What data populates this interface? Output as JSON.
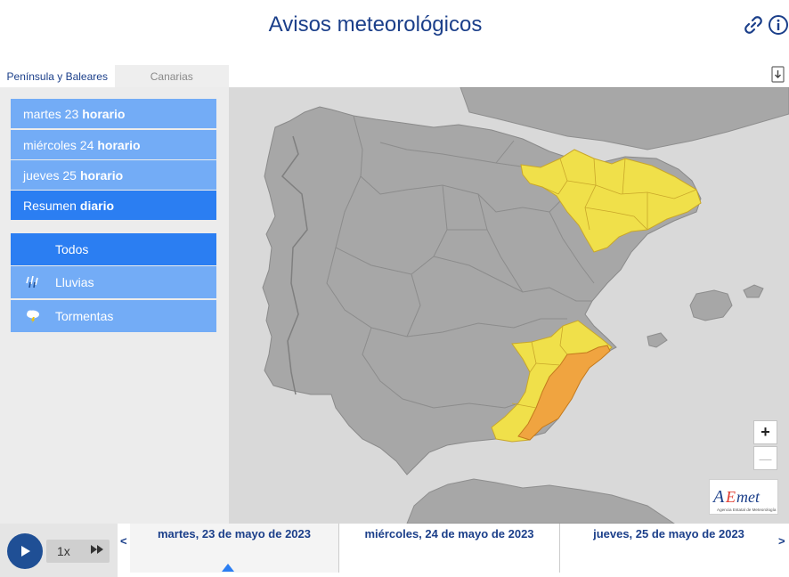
{
  "header": {
    "title": "Avisos meteorológicos",
    "icons": [
      "link-icon",
      "info-icon"
    ]
  },
  "tabs": [
    {
      "label": "Península y Baleares",
      "active": true
    },
    {
      "label": "Canarias",
      "active": false
    }
  ],
  "days": [
    {
      "day": "martes 23",
      "suffix": "horario",
      "active": false
    },
    {
      "day": "miércoles 24",
      "suffix": "horario",
      "active": false
    },
    {
      "day": "jueves 25",
      "suffix": "horario",
      "active": false
    },
    {
      "day": "Resumen",
      "suffix": "diario",
      "active": true
    }
  ],
  "filters": [
    {
      "label": "Todos",
      "icon": "",
      "active": true
    },
    {
      "label": "Lluvias",
      "icon": "rain-icon",
      "active": false
    },
    {
      "label": "Tormentas",
      "icon": "storm-icon",
      "active": false
    }
  ],
  "map": {
    "download_icon": "download-icon",
    "zoom_in": "+",
    "zoom_out": "—",
    "logo": {
      "text": "AEmet",
      "subtext": "Agencia Estatal de Meteorología"
    },
    "colors": {
      "land": "#a7a7a7",
      "sea": "#d9d9d9",
      "yellow": "#f0e04a",
      "orange": "#f0a440"
    }
  },
  "timeline": {
    "speed": "1x",
    "prev": "<",
    "next": ">",
    "dates": [
      {
        "label": "martes, 23 de mayo de 2023",
        "selected": true
      },
      {
        "label": "miércoles, 24 de mayo de 2023",
        "selected": false
      },
      {
        "label": "jueves, 25 de mayo de 2023",
        "selected": false
      }
    ]
  }
}
